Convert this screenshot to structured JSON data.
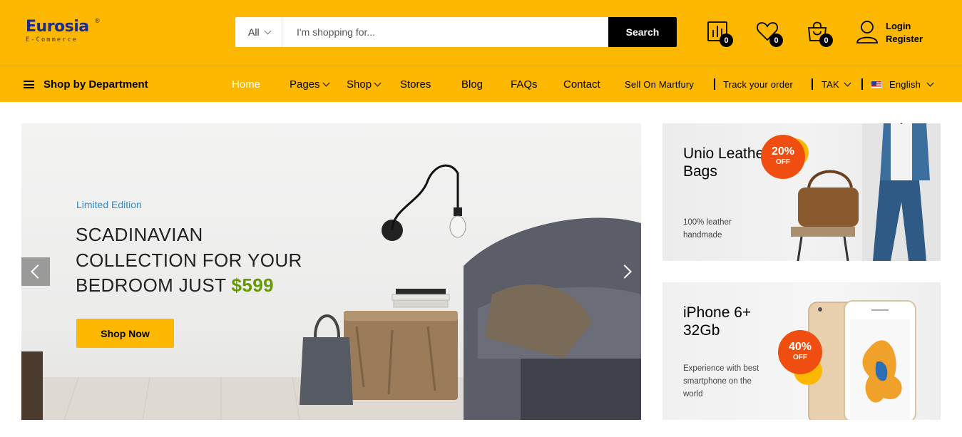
{
  "header": {
    "logo": {
      "name": "Eurosia",
      "tagline": "E-Commerce",
      "registered": "®"
    },
    "search": {
      "category": "All",
      "placeholder": "I'm shopping for...",
      "button_label": "Search"
    },
    "compare_count": "0",
    "wishlist_count": "0",
    "cart_count": "0",
    "account": {
      "login_label": "Login",
      "register_label": "Register"
    }
  },
  "nav": {
    "department_label": "Shop by Department",
    "items": [
      {
        "label": "Home",
        "active": true
      },
      {
        "label": "Pages",
        "has_dropdown": true
      },
      {
        "label": "Shop",
        "has_dropdown": true
      },
      {
        "label": "Stores"
      },
      {
        "label": "Blog"
      },
      {
        "label": "FAQs"
      },
      {
        "label": "Contact"
      }
    ],
    "right": {
      "sell_label": "Sell On Martfury",
      "track_label": "Track your order",
      "currency": "TAK",
      "language": "English"
    }
  },
  "hero": {
    "label": "Limited Edition",
    "title_lines": [
      "SCADINAVIAN",
      "COLLECTION FOR YOUR",
      "BEDROOM JUST"
    ],
    "price": "$599",
    "button_label": "Shop Now"
  },
  "promos": [
    {
      "title": "Unio Leather Bags",
      "description": "100% leather handmade",
      "discount_pct": "20%",
      "discount_label": "OFF"
    },
    {
      "title": "iPhone 6+ 32Gb",
      "description": "Experience with best smartphone on the world",
      "discount_pct": "40%",
      "discount_label": "OFF"
    }
  ],
  "colors": {
    "brand_yellow": "#fcb800",
    "black": "#000000",
    "price_green": "#669900",
    "label_blue": "#2c8fc9",
    "discount_orange": "#f04e11"
  }
}
